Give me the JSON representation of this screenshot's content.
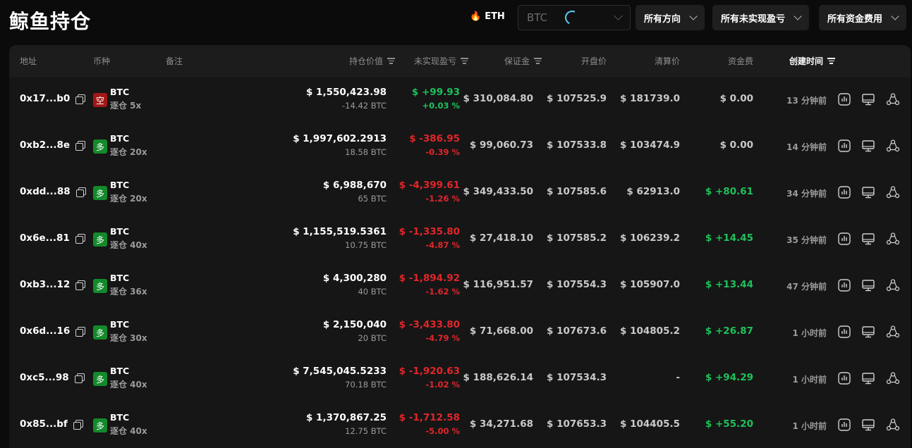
{
  "header": {
    "title": "鲸鱼持仓",
    "eth_label": "ETH",
    "search_value": "BTC",
    "filters": [
      "所有方向",
      "所有未实现盈亏",
      "所有资金费用"
    ]
  },
  "columns": {
    "address": "地址",
    "coin": "币种",
    "note": "备注",
    "position_value": "持仓价值",
    "unrealized_pnl": "未实现盈亏",
    "margin": "保证金",
    "open_price": "开盘价",
    "liq_price": "清算价",
    "funding": "资金费",
    "created": "创建时间"
  },
  "rows": [
    {
      "address": "0x17...b0",
      "side": "空",
      "direction": "short",
      "coin": "BTC",
      "mode": "逐仓 5x",
      "value": "$ 1,550,423.98",
      "size": "-14.42 BTC",
      "pnl": "$ +99.93",
      "pnl_pct": "+0.03 %",
      "pnl_sign": "pos",
      "margin": "$ 310,084.80",
      "open": "$ 107525.9",
      "liq": "$ 181739.0",
      "funding": "$ 0.00",
      "funding_sign": "neutral",
      "time": "13 分钟前"
    },
    {
      "address": "0xb2...8e",
      "side": "多",
      "direction": "long",
      "coin": "BTC",
      "mode": "逐仓 20x",
      "value": "$ 1,997,602.2913",
      "size": "18.58 BTC",
      "pnl": "$ -386.95",
      "pnl_pct": "-0.39 %",
      "pnl_sign": "neg",
      "margin": "$ 99,060.73",
      "open": "$ 107533.8",
      "liq": "$ 103474.9",
      "funding": "$ 0.00",
      "funding_sign": "neutral",
      "time": "14 分钟前"
    },
    {
      "address": "0xdd...88",
      "side": "多",
      "direction": "long",
      "coin": "BTC",
      "mode": "逐仓 20x",
      "value": "$ 6,988,670",
      "size": "65 BTC",
      "pnl": "$ -4,399.61",
      "pnl_pct": "-1.26 %",
      "pnl_sign": "neg",
      "margin": "$ 349,433.50",
      "open": "$ 107585.6",
      "liq": "$ 62913.0",
      "funding": "$ +80.61",
      "funding_sign": "pos",
      "time": "34 分钟前"
    },
    {
      "address": "0x6e...81",
      "side": "多",
      "direction": "long",
      "coin": "BTC",
      "mode": "逐仓 40x",
      "value": "$ 1,155,519.5361",
      "size": "10.75 BTC",
      "pnl": "$ -1,335.80",
      "pnl_pct": "-4.87 %",
      "pnl_sign": "neg",
      "margin": "$ 27,418.10",
      "open": "$ 107585.2",
      "liq": "$ 106239.2",
      "funding": "$ +14.45",
      "funding_sign": "pos",
      "time": "35 分钟前"
    },
    {
      "address": "0xb3...12",
      "side": "多",
      "direction": "long",
      "coin": "BTC",
      "mode": "逐仓 36x",
      "value": "$ 4,300,280",
      "size": "40 BTC",
      "pnl": "$ -1,894.92",
      "pnl_pct": "-1.62 %",
      "pnl_sign": "neg",
      "margin": "$ 116,951.57",
      "open": "$ 107554.3",
      "liq": "$ 105907.0",
      "funding": "$ +13.44",
      "funding_sign": "pos",
      "time": "47 分钟前"
    },
    {
      "address": "0x6d...16",
      "side": "多",
      "direction": "long",
      "coin": "BTC",
      "mode": "逐仓 30x",
      "value": "$ 2,150,040",
      "size": "20 BTC",
      "pnl": "$ -3,433.80",
      "pnl_pct": "-4.79 %",
      "pnl_sign": "neg",
      "margin": "$ 71,668.00",
      "open": "$ 107673.6",
      "liq": "$ 104805.2",
      "funding": "$ +26.87",
      "funding_sign": "pos",
      "time": "1 小时前"
    },
    {
      "address": "0xc5...98",
      "side": "多",
      "direction": "long",
      "coin": "BTC",
      "mode": "逐仓 40x",
      "value": "$ 7,545,045.5233",
      "size": "70.18 BTC",
      "pnl": "$ -1,920.63",
      "pnl_pct": "-1.02 %",
      "pnl_sign": "neg",
      "margin": "$ 188,626.14",
      "open": "$ 107534.3",
      "liq": "-",
      "funding": "$ +94.29",
      "funding_sign": "pos",
      "time": "1 小时前"
    },
    {
      "address": "0x85...bf",
      "side": "多",
      "direction": "long",
      "coin": "BTC",
      "mode": "逐仓 40x",
      "value": "$ 1,370,867.25",
      "size": "12.75 BTC",
      "pnl": "$ -1,712.58",
      "pnl_pct": "-5.00 %",
      "pnl_sign": "neg",
      "margin": "$ 34,271.68",
      "open": "$ 107653.3",
      "liq": "$ 104405.5",
      "funding": "$ +55.20",
      "funding_sign": "pos",
      "time": "1 小时前"
    }
  ],
  "icons": {
    "row_actions": [
      "chart-icon",
      "monitor-icon",
      "share-icon"
    ],
    "fire": "fire-icon",
    "copy": "copy-icon"
  },
  "colors": {
    "positive": "#1fc15b",
    "negative": "#e0262b",
    "short_badge": "#a31717",
    "long_badge": "#138a2b"
  }
}
